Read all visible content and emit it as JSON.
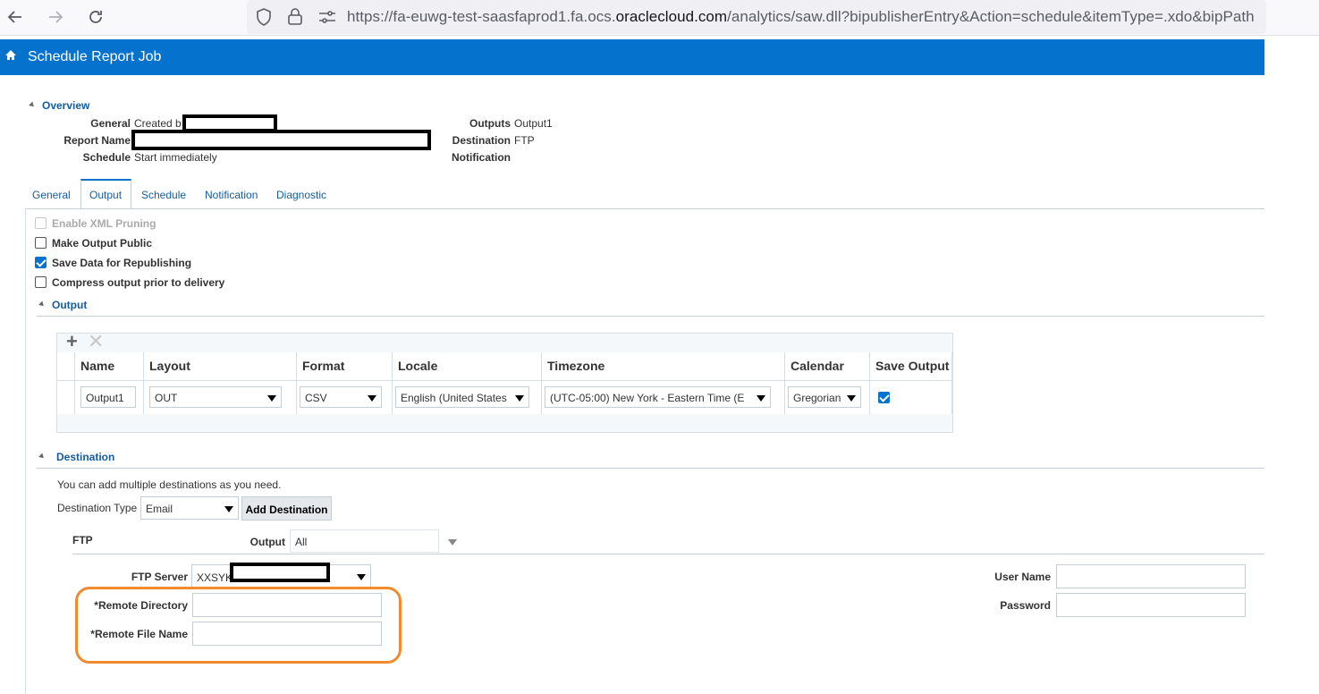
{
  "browser": {
    "url_prefix": "https://fa-euwg-test-saasfaprod1.fa.ocs.",
    "url_domain": "oraclecloud.com",
    "url_suffix": "/analytics/saw.dll?bipublisherEntry&Action=schedule&itemType=.xdo&bipPath"
  },
  "header": {
    "title": "Schedule Report Job"
  },
  "overview": {
    "section_title": "Overview",
    "general_label": "General",
    "general_value": "Created b",
    "report_name_label": "Report Name",
    "schedule_label": "Schedule",
    "schedule_value": "Start immediately",
    "outputs_label": "Outputs",
    "outputs_value": "Output1",
    "destination_label": "Destination",
    "destination_value": "FTP",
    "notification_label": "Notification"
  },
  "tabs": [
    {
      "label": "General"
    },
    {
      "label": "Output"
    },
    {
      "label": "Schedule"
    },
    {
      "label": "Notification"
    },
    {
      "label": "Diagnostic"
    }
  ],
  "options": {
    "enable_xml_pruning": {
      "label": "Enable XML Pruning",
      "checked": false,
      "disabled": true
    },
    "make_output_public": {
      "label": "Make Output Public",
      "checked": false
    },
    "save_data": {
      "label": "Save Data for Republishing",
      "checked": true
    },
    "compress_output": {
      "label": "Compress output prior to delivery",
      "checked": false
    }
  },
  "output_section": {
    "title": "Output",
    "columns": [
      "Name",
      "Layout",
      "Format",
      "Locale",
      "Timezone",
      "Calendar",
      "Save Output"
    ],
    "row": {
      "name": "Output1",
      "layout": "OUT",
      "format": "CSV",
      "locale": "English (United States",
      "timezone": "(UTC-05:00) New York - Eastern Time (E",
      "calendar": "Gregorian",
      "save_output": true
    }
  },
  "destination_section": {
    "title": "Destination",
    "hint": "You can add multiple destinations as you need.",
    "type_label": "Destination Type",
    "type_value": "Email",
    "add_button": "Add Destination"
  },
  "ftp": {
    "title": "FTP",
    "output_label": "Output",
    "output_value": "All",
    "server_label": "FTP Server",
    "server_value": "XXSYK",
    "remote_dir_label": "*Remote Directory",
    "remote_dir_value": "",
    "remote_file_label": "*Remote File Name",
    "remote_file_value": "",
    "user_name_label": "User Name",
    "user_name_value": "",
    "password_label": "Password",
    "password_value": ""
  },
  "colors": {
    "header_bg": "#0572ce",
    "link": "#145c9e",
    "highlight_ring": "#f28a2e"
  }
}
